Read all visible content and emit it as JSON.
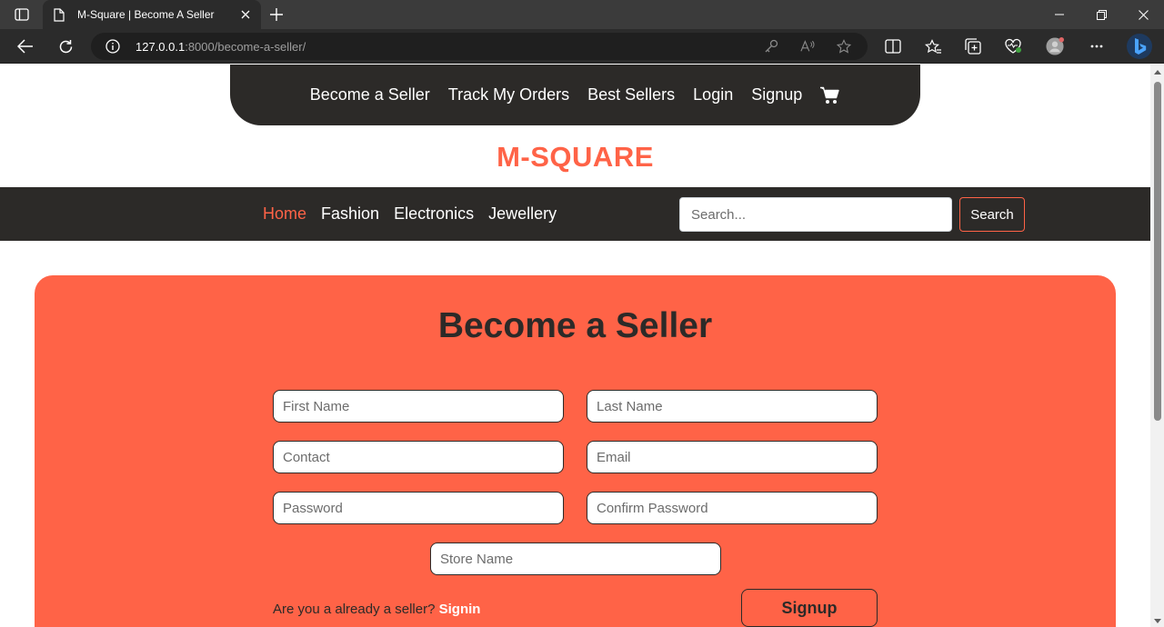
{
  "browser": {
    "tab_title": "M-Square | Become A Seller",
    "url_host": "127.0.0.1",
    "url_rest": ":8000/become-a-seller/"
  },
  "topnav": {
    "items": [
      "Become a Seller",
      "Track My Orders",
      "Best Sellers",
      "Login",
      "Signup"
    ],
    "cart_icon": "cart-icon"
  },
  "brand": {
    "name": "M-SQUARE"
  },
  "categories": {
    "items": [
      "Home",
      "Fashion",
      "Electronics",
      "Jewellery"
    ],
    "active": "Home"
  },
  "search": {
    "placeholder": "Search...",
    "button_label": "Search"
  },
  "form": {
    "title": "Become a Seller",
    "first_name_placeholder": "First Name",
    "last_name_placeholder": "Last Name",
    "contact_placeholder": "Contact",
    "email_placeholder": "Email",
    "password_placeholder": "Password",
    "confirm_password_placeholder": "Confirm Password",
    "store_name_placeholder": "Store Name",
    "already_text": "Are you a already a seller?",
    "signin_label": "Signin",
    "signup_label": "Signup"
  },
  "colors": {
    "accent": "#ff6347",
    "dark": "#2c2a28"
  }
}
